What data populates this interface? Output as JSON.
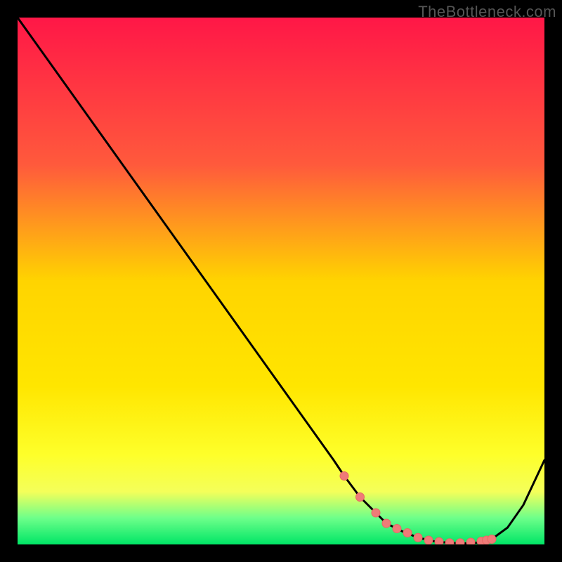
{
  "watermark": "TheBottleneck.com",
  "colors": {
    "frame": "#000000",
    "curve": "#000000",
    "marker_fill": "#ef7b78",
    "marker_stroke": "#e86864",
    "grad_top": "#ff1747",
    "grad_mid_hi": "#ff8040",
    "grad_mid": "#ffd400",
    "grad_lo1": "#feff2a",
    "grad_lo2": "#f4ff5a",
    "grad_lo3": "#c9ff6a",
    "grad_lo4": "#6dff8a",
    "grad_bottom": "#00e566"
  },
  "chart_data": {
    "type": "line",
    "title": "",
    "xlabel": "",
    "ylabel": "",
    "xlim": [
      0,
      100
    ],
    "ylim": [
      0,
      100
    ],
    "x": [
      0,
      5,
      10,
      15,
      20,
      25,
      30,
      35,
      40,
      45,
      50,
      55,
      60,
      62,
      65,
      68,
      70,
      73,
      76,
      79,
      82,
      85,
      88,
      90,
      93,
      96,
      100
    ],
    "y": [
      100,
      93,
      86,
      79,
      72,
      65,
      58,
      51,
      44,
      37,
      30,
      23,
      16,
      13,
      9,
      6,
      4,
      2.5,
      1.3,
      0.6,
      0.3,
      0.2,
      0.4,
      1.0,
      3.2,
      7.5,
      16
    ],
    "markers": {
      "x": [
        62,
        65,
        68,
        70,
        72,
        74,
        76,
        78,
        80,
        82,
        84,
        86,
        88,
        89,
        90
      ],
      "y": [
        13,
        9,
        6,
        4,
        3,
        2.2,
        1.3,
        0.8,
        0.5,
        0.3,
        0.3,
        0.4,
        0.6,
        0.8,
        1.0
      ]
    }
  }
}
